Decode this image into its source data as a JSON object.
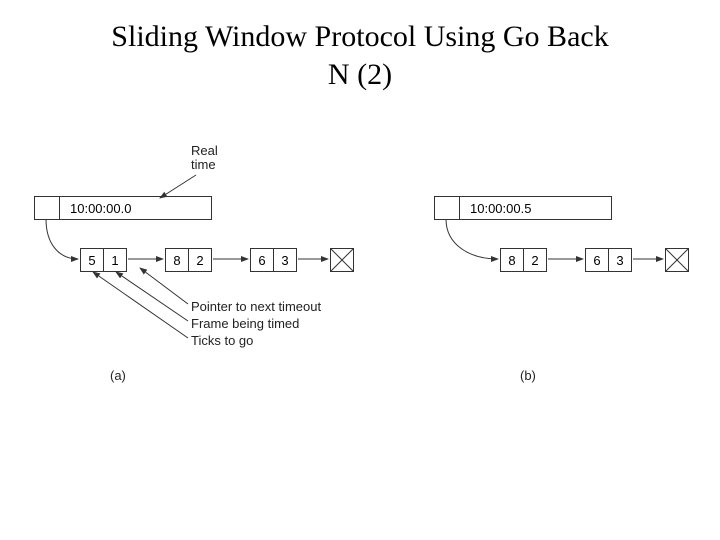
{
  "title_line1": "Sliding Window Protocol Using Go Back",
  "title_line2": "N (2)",
  "labels": {
    "real_time1": "Real",
    "real_time2": "time",
    "annot1": "Pointer to next timeout",
    "annot2": "Frame being timed",
    "annot3": "Ticks to go",
    "part_a": "(a)",
    "part_b": "(b)"
  },
  "left": {
    "clock": "10:00:00.0",
    "nodes": [
      {
        "ticks": "5",
        "frame": "1"
      },
      {
        "ticks": "8",
        "frame": "2"
      },
      {
        "ticks": "6",
        "frame": "3"
      }
    ]
  },
  "right": {
    "clock": "10:00:00.5",
    "nodes": [
      {
        "ticks": "8",
        "frame": "2"
      },
      {
        "ticks": "6",
        "frame": "3"
      }
    ]
  }
}
